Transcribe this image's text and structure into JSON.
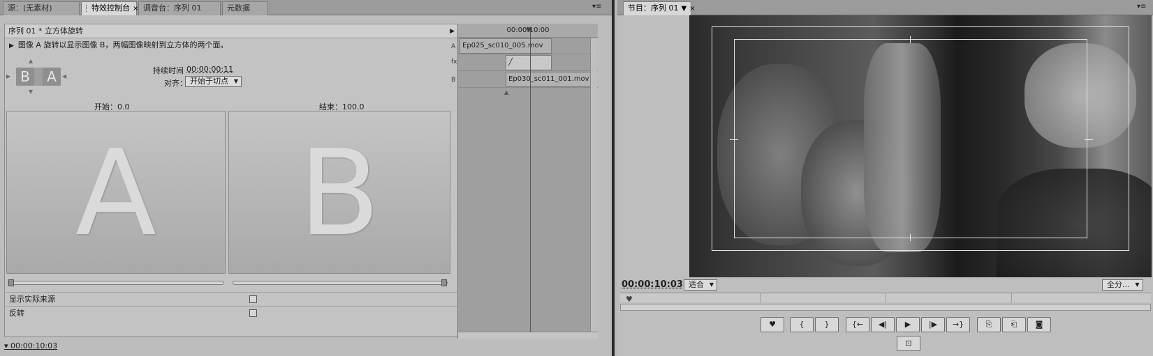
{
  "left_tabs": [
    {
      "label": "源：(无素材)"
    },
    {
      "label": "特效控制台",
      "active": true
    },
    {
      "label": "调音台：序列 01"
    },
    {
      "label": "元数据"
    }
  ],
  "effects": {
    "header": "序列 01 * 立方体旋转",
    "description": "图像 A 旋转以显示图像 B，两幅图像映射到立方体的两个面。",
    "thumb_a": "B",
    "thumb_b": "A",
    "duration_label": "持续时间",
    "duration_value": "00:00:00:11",
    "alignment_label": "对齐：",
    "alignment_value": "开始于切点",
    "start_label": "开始：0.0",
    "end_label": "结束：100.0",
    "preview_a_letter": "A",
    "preview_b_letter": "B",
    "start_value": 0.0,
    "end_value": 100.0,
    "show_actual_sources_label": "显示实际来源",
    "reverse_label": "反转",
    "status_time": "00:00:10:03"
  },
  "mini_timeline": {
    "time": "00:00:10:00",
    "track_a_label": "A",
    "track_fx_label": "fx",
    "track_b_label": "B",
    "clip_a": "Ep025_sc010_005.mov",
    "clip_b": "Ep030_sc011_001.mov"
  },
  "program": {
    "tab_label": "节目：序列 01",
    "timecode": "00:00:10:03",
    "fit_value": "适合",
    "resolution_value": "全分...",
    "controls": [
      "♥",
      "{",
      "}",
      "{←",
      "◀|",
      "▶",
      "|▶",
      "→}",
      "⎘",
      "⎗",
      "◙"
    ],
    "trim_icon": "⊡"
  }
}
